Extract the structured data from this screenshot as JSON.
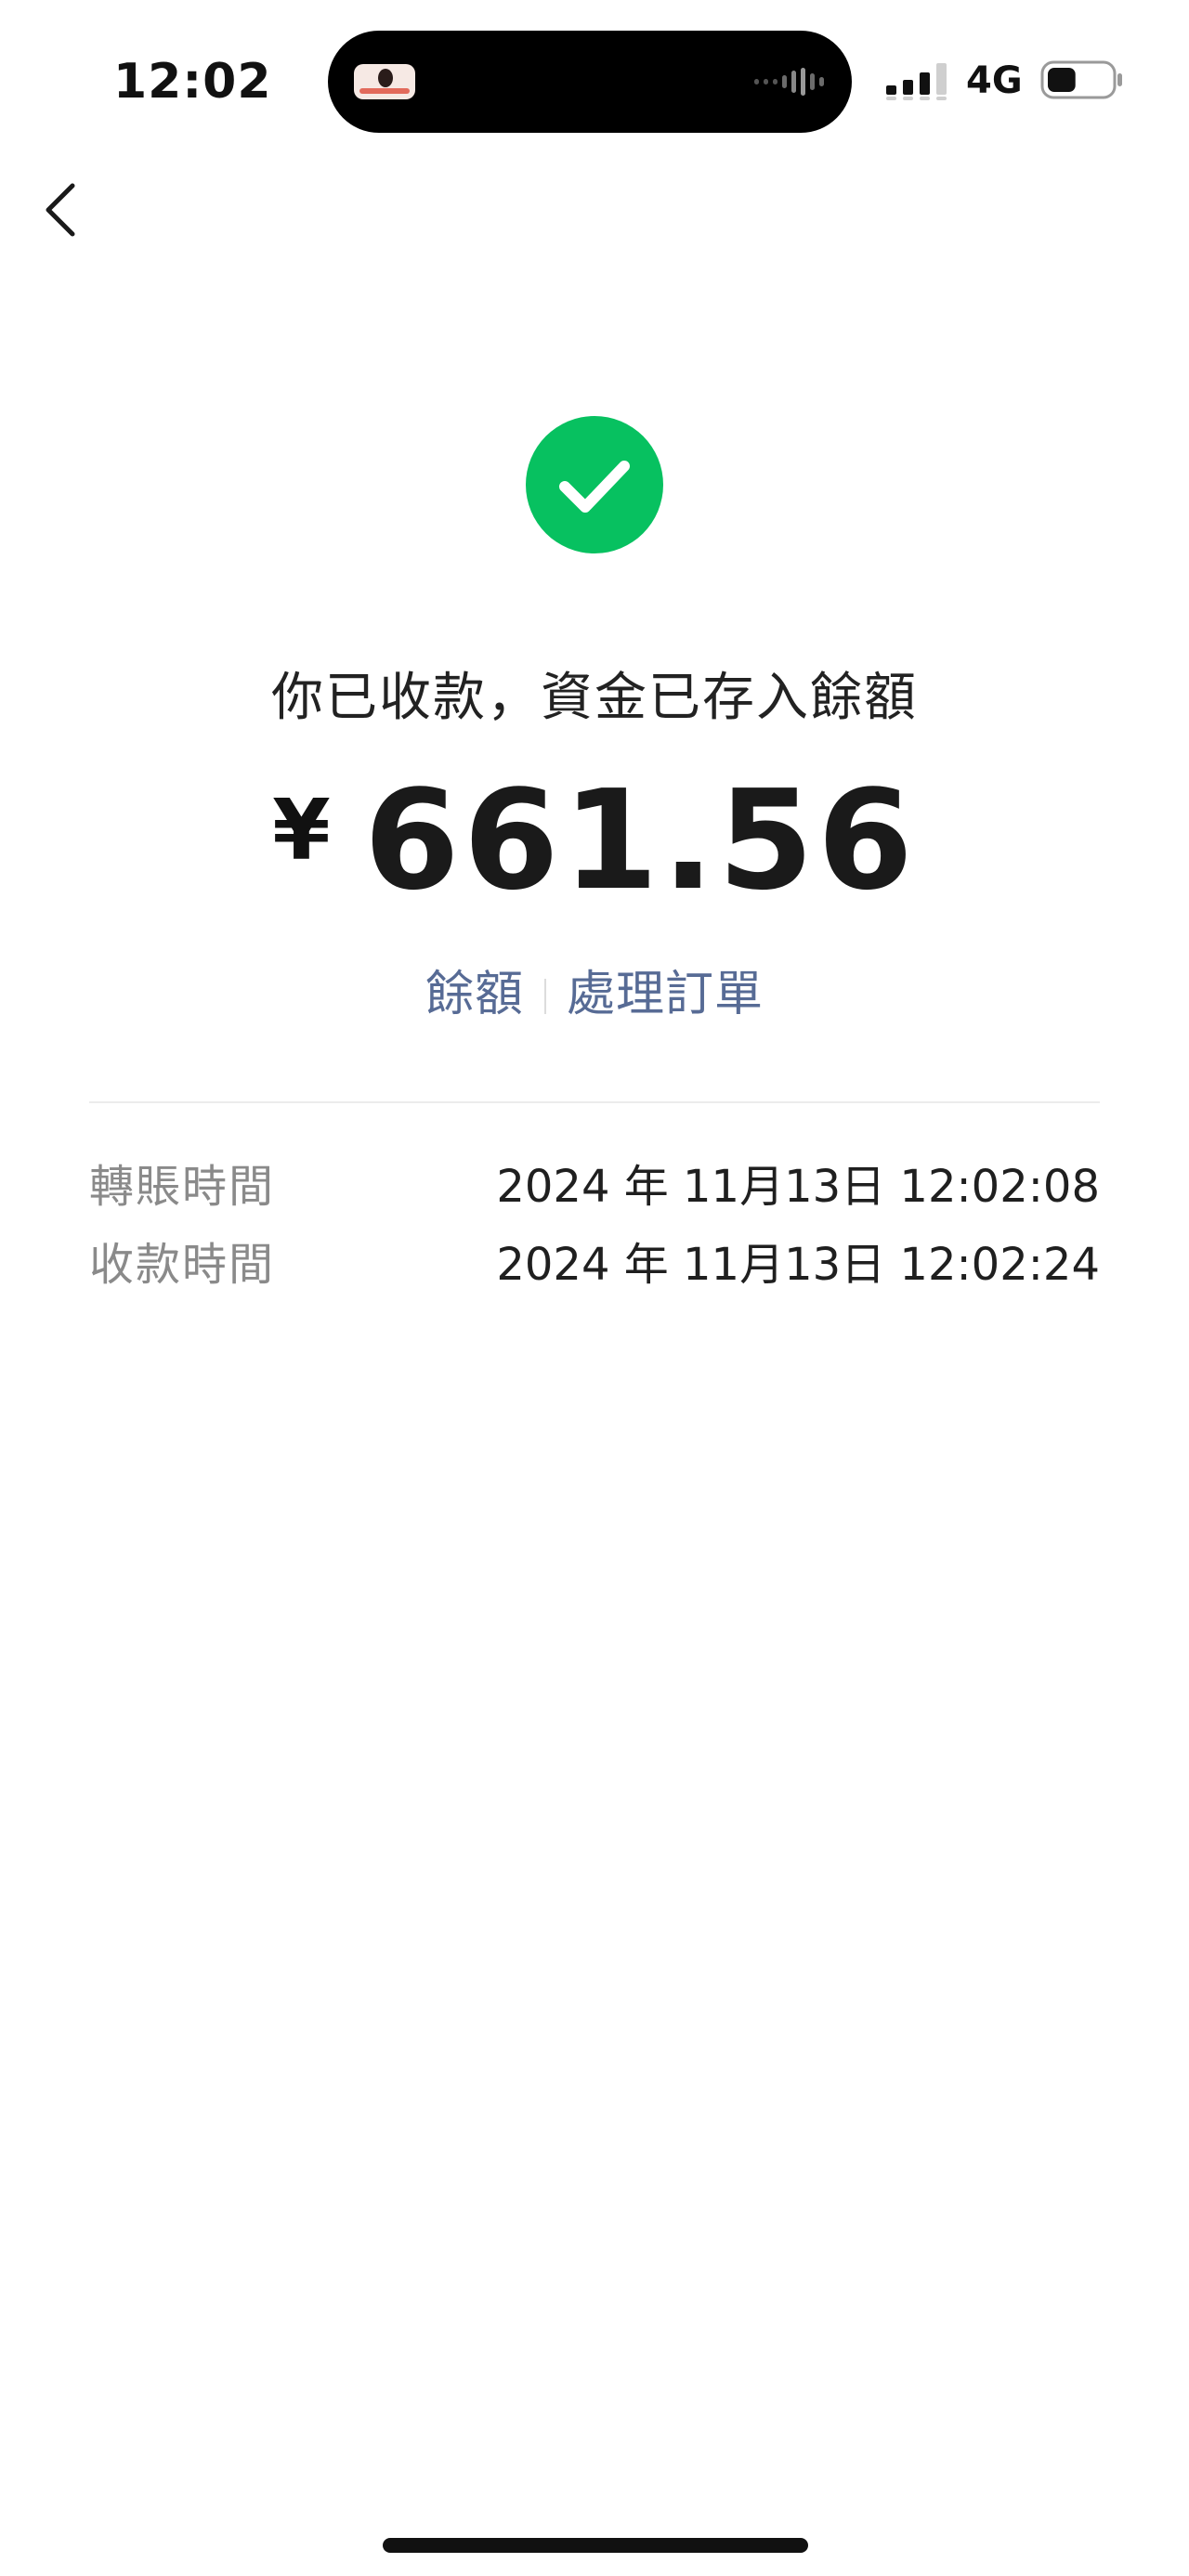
{
  "status_bar": {
    "time": "12:02",
    "network": "4G",
    "signal_icon": "signal-bars-icon",
    "battery_icon": "battery-icon",
    "battery_level": 0.45
  },
  "nav": {
    "back_icon": "chevron-left-icon"
  },
  "receipt": {
    "status_icon": "check-circle-icon",
    "status_color": "#07c160",
    "headline": "你已收款，資金已存入餘額",
    "currency": "¥",
    "amount": "661.56",
    "links": [
      {
        "label": "餘額"
      },
      {
        "label": "處理訂單"
      }
    ],
    "link_color": "#576b95"
  },
  "details": [
    {
      "label": "轉賬時間",
      "value": "2024 年 11月13日 12:02:08"
    },
    {
      "label": "收款時間",
      "value": "2024 年 11月13日 12:02:24"
    }
  ]
}
